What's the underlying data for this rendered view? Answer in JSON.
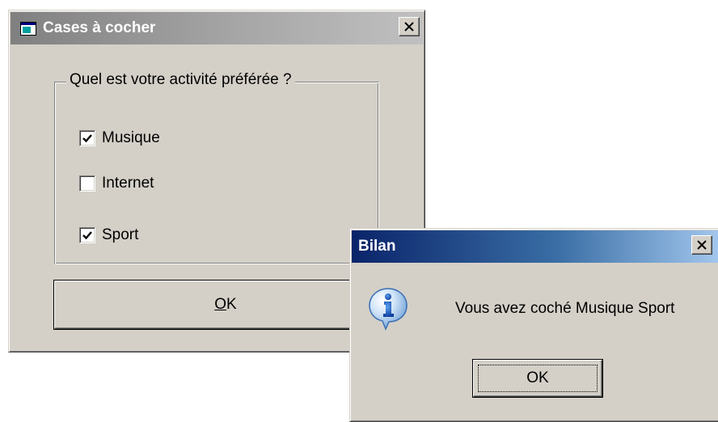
{
  "main_window": {
    "title": "Cases à cocher",
    "close_glyph": "×",
    "group_label": "Quel est votre activité préférée ?",
    "checkboxes": [
      {
        "label": "Musique",
        "checked": true
      },
      {
        "label": "Internet",
        "checked": false
      },
      {
        "label": "Sport",
        "checked": true
      }
    ],
    "ok_accel": "O",
    "ok_rest": "K"
  },
  "message_box": {
    "title": "Bilan",
    "close_glyph": "×",
    "icon": "info-icon",
    "message": "Vous avez coché  Musique Sport",
    "ok_label": "OK"
  },
  "colors": {
    "face": "#d4d0c8",
    "inactive_title": "#808080",
    "active_title": "#0a246a",
    "info_icon": "#1565c0"
  }
}
